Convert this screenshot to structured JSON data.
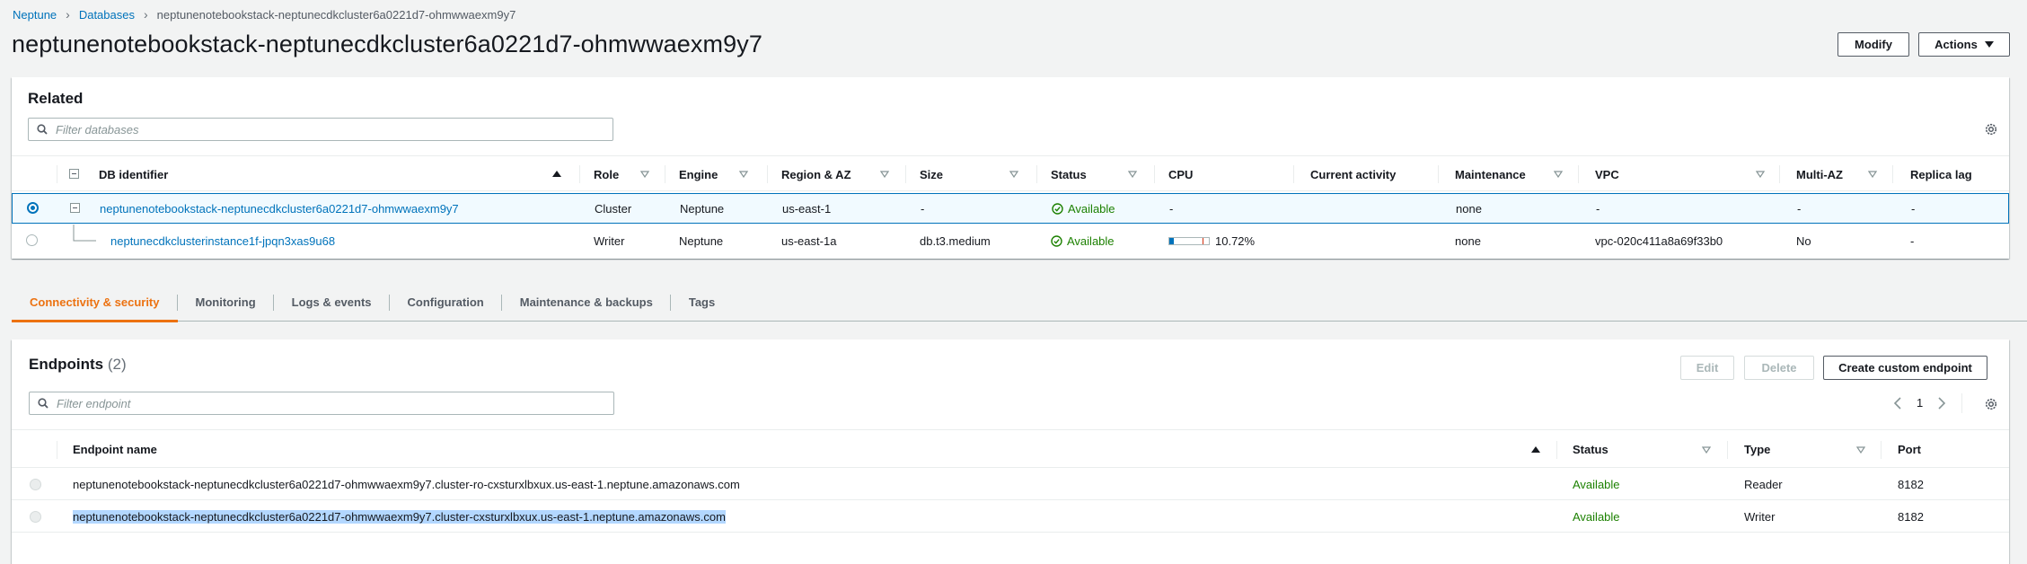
{
  "breadcrumb": {
    "items": [
      "Neptune",
      "Databases"
    ],
    "current": "neptunenotebookstack-neptunecdkcluster6a0221d7-ohmwwaexm9y7"
  },
  "page": {
    "title": "neptunenotebookstack-neptunecdkcluster6a0221d7-ohmwwaexm9y7"
  },
  "header_actions": {
    "modify_label": "Modify",
    "actions_label": "Actions"
  },
  "related": {
    "title": "Related",
    "filter_placeholder": "Filter databases",
    "columns": [
      "DB identifier",
      "Role",
      "Engine",
      "Region & AZ",
      "Size",
      "Status",
      "CPU",
      "Current activity",
      "Maintenance",
      "VPC",
      "Multi-AZ",
      "Replica lag"
    ],
    "rows": [
      {
        "db_identifier": "neptunenotebookstack-neptunecdkcluster6a0221d7-ohmwwaexm9y7",
        "role": "Cluster",
        "engine": "Neptune",
        "region_az": "us-east-1",
        "size": "-",
        "status": "Available",
        "cpu": "-",
        "current_activity": "",
        "maintenance": "none",
        "vpc": "-",
        "multi_az": "-",
        "replica_lag": "-"
      },
      {
        "db_identifier": "neptunecdkclusterinstance1f-jpqn3xas9u68",
        "role": "Writer",
        "engine": "Neptune",
        "region_az": "us-east-1a",
        "size": "db.t3.medium",
        "status": "Available",
        "cpu": "10.72%",
        "cpu_fraction": 0.1072,
        "current_activity": "",
        "maintenance": "none",
        "vpc": "vpc-020c411a8a69f33b0",
        "multi_az": "No",
        "replica_lag": "-"
      }
    ]
  },
  "tabs": [
    {
      "label": "Connectivity & security",
      "active": true
    },
    {
      "label": "Monitoring",
      "active": false
    },
    {
      "label": "Logs & events",
      "active": false
    },
    {
      "label": "Configuration",
      "active": false
    },
    {
      "label": "Maintenance & backups",
      "active": false
    },
    {
      "label": "Tags",
      "active": false
    }
  ],
  "endpoints": {
    "title": "Endpoints",
    "count": "(2)",
    "edit_label": "Edit",
    "delete_label": "Delete",
    "create_label": "Create custom endpoint",
    "filter_placeholder": "Filter endpoint",
    "page_number": "1",
    "columns": [
      "Endpoint name",
      "Status",
      "Type",
      "Port"
    ],
    "rows": [
      {
        "name": "neptunenotebookstack-neptunecdkcluster6a0221d7-ohmwwaexm9y7.cluster-ro-cxsturxlbxux.us-east-1.neptune.amazonaws.com",
        "status": "Available",
        "type": "Reader",
        "port": "8182"
      },
      {
        "name": "neptunenotebookstack-neptunecdkcluster6a0221d7-ohmwwaexm9y7.cluster-cxsturxlbxux.us-east-1.neptune.amazonaws.com",
        "status": "Available",
        "type": "Writer",
        "port": "8182"
      }
    ]
  },
  "colors": {
    "link": "#0073bb",
    "accent_tab": "#ec7211",
    "success": "#1d8102",
    "selected_row_border": "#0073bb",
    "selected_row_bg": "#f1faff"
  }
}
